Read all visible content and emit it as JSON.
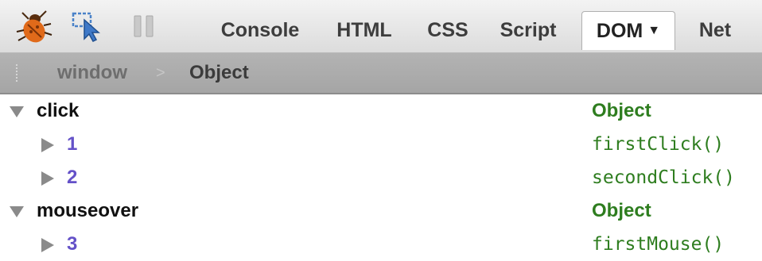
{
  "toolbar": {
    "icons": [
      "firebug-bug-icon",
      "inspect-cursor-icon",
      "pause-icon"
    ],
    "tabs": [
      {
        "label": "Console",
        "active": false
      },
      {
        "label": "HTML",
        "active": false
      },
      {
        "label": "CSS",
        "active": false
      },
      {
        "label": "Script",
        "active": false
      },
      {
        "label": "DOM",
        "active": true,
        "has_dropdown": true
      },
      {
        "label": "Net",
        "active": false
      }
    ]
  },
  "breadcrumb": {
    "items": [
      "window",
      "Object"
    ],
    "separator": ">"
  },
  "dom_tree": [
    {
      "name": "click",
      "value": "Object",
      "expanded": true,
      "level": 0
    },
    {
      "name": "1",
      "value": "firstClick()",
      "expanded": false,
      "level": 1
    },
    {
      "name": "2",
      "value": "secondClick()",
      "expanded": false,
      "level": 1
    },
    {
      "name": "mouseover",
      "value": "Object",
      "expanded": true,
      "level": 0
    },
    {
      "name": "3",
      "value": "firstMouse()",
      "expanded": false,
      "level": 1
    }
  ],
  "colors": {
    "property_child": "#6451c8",
    "value": "#2e7d1f",
    "breadcrumb_bar": "#aaaaaa"
  }
}
